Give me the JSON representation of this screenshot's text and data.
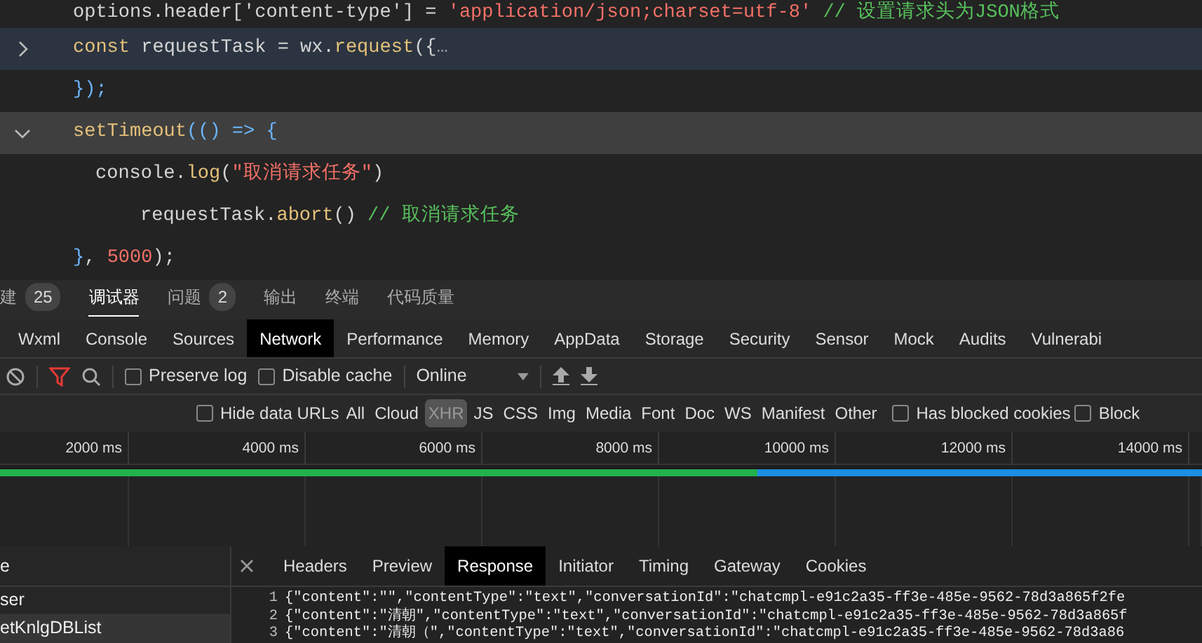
{
  "editor": {
    "lines": [
      {
        "current": false,
        "hovered": false,
        "tokens": [
          {
            "kind": "plain",
            "text": "options.header['content-type'] = "
          },
          {
            "kind": "string",
            "text": "'application/json;charset=utf-8'"
          },
          {
            "kind": "comment",
            "text": " // 设置请求头为JSON格式"
          }
        ]
      },
      {
        "current": true,
        "hovered": false,
        "expanded": false,
        "tokens": [
          {
            "kind": "keyword",
            "text": "const"
          },
          {
            "kind": "plain",
            "text": " requestTask =  wx."
          },
          {
            "kind": "function",
            "text": "request"
          },
          {
            "kind": "plain",
            "text": "({"
          },
          {
            "kind": "muted",
            "text": "…"
          }
        ]
      },
      {
        "current": false,
        "hovered": false,
        "tokens": [
          {
            "kind": "punct",
            "text": "});"
          }
        ]
      },
      {
        "current": false,
        "hovered": true,
        "expanded": true,
        "tokens": [
          {
            "kind": "function",
            "text": "setTimeout"
          },
          {
            "kind": "punct",
            "text": "(() => {"
          }
        ],
        "children": [
          {
            "current": false,
            "hovered": false,
            "tokens": [
              {
                "kind": "plain",
                "text": "console."
              },
              {
                "kind": "function",
                "text": "log"
              },
              {
                "kind": "plain",
                "text": "("
              },
              {
                "kind": "string",
                "text": "\"取消请求任务\""
              },
              {
                "kind": "plain",
                "text": ")"
              }
            ],
            "children": [
              {
                "current": false,
                "hovered": false,
                "tokens": [
                  {
                    "kind": "plain",
                    "text": "requestTask."
                  },
                  {
                    "kind": "function",
                    "text": "abort"
                  },
                  {
                    "kind": "plain",
                    "text": "() "
                  },
                  {
                    "kind": "comment",
                    "text": "// 取消请求任务"
                  }
                ]
              }
            ]
          }
        ]
      },
      {
        "current": false,
        "hovered": false,
        "tokens": [
          {
            "kind": "punct",
            "text": "}"
          },
          {
            "kind": "plain",
            "text": ", "
          },
          {
            "kind": "number",
            "text": "5000"
          },
          {
            "kind": "plain",
            "text": ");"
          }
        ]
      }
    ]
  },
  "panel_tabs": [
    {
      "label": "建",
      "count": "25",
      "selected": false
    },
    {
      "label": "调试器",
      "selected": true
    },
    {
      "label": "问题",
      "count": "2",
      "selected": false
    },
    {
      "label": "输出",
      "selected": false
    },
    {
      "label": "终端",
      "selected": false
    },
    {
      "label": "代码质量",
      "selected": false
    }
  ],
  "devtools_tabs": [
    {
      "label": "Wxml",
      "selected": false
    },
    {
      "label": "Console",
      "selected": false
    },
    {
      "label": "Sources",
      "selected": false
    },
    {
      "label": "Network",
      "selected": true
    },
    {
      "label": "Performance",
      "selected": false
    },
    {
      "label": "Memory",
      "selected": false
    },
    {
      "label": "AppData",
      "selected": false
    },
    {
      "label": "Storage",
      "selected": false
    },
    {
      "label": "Security",
      "selected": false
    },
    {
      "label": "Sensor",
      "selected": false
    },
    {
      "label": "Mock",
      "selected": false
    },
    {
      "label": "Audits",
      "selected": false
    },
    {
      "label": "Vulnerabi",
      "selected": false
    }
  ],
  "toolbar": {
    "preserve_log": {
      "label": "Preserve log",
      "checked": false
    },
    "disable_cache": {
      "label": "Disable cache",
      "checked": false
    },
    "throttling": "Online"
  },
  "filters": {
    "hide_data_urls": {
      "label": "Hide data URLs",
      "checked": false
    },
    "types": [
      {
        "label": "All",
        "selected": false
      },
      {
        "label": "Cloud",
        "selected": false
      },
      {
        "label": "XHR",
        "selected": true
      },
      {
        "label": "JS",
        "selected": false
      },
      {
        "label": "CSS",
        "selected": false
      },
      {
        "label": "Img",
        "selected": false
      },
      {
        "label": "Media",
        "selected": false
      },
      {
        "label": "Font",
        "selected": false
      },
      {
        "label": "Doc",
        "selected": false
      },
      {
        "label": "WS",
        "selected": false
      },
      {
        "label": "Manifest",
        "selected": false
      },
      {
        "label": "Other",
        "selected": false
      }
    ],
    "has_blocked_cookies": {
      "label": "Has blocked cookies",
      "checked": false
    },
    "blocked": {
      "label": "Block",
      "checked": false
    }
  },
  "timeline": {
    "ticks": [
      "2000 ms",
      "4000 ms",
      "6000 ms",
      "8000 ms",
      "10000 ms",
      "12000 ms",
      "14000 ms"
    ],
    "level": 0.63
  },
  "requests_header": "e",
  "requests": [
    {
      "name": "ser",
      "selected": false
    },
    {
      "name": "etKnlgDBList",
      "selected": true
    }
  ],
  "detail_tabs": [
    {
      "label": "Headers",
      "selected": false
    },
    {
      "label": "Preview",
      "selected": false
    },
    {
      "label": "Response",
      "selected": true
    },
    {
      "label": "Initiator",
      "selected": false
    },
    {
      "label": "Timing",
      "selected": false
    },
    {
      "label": "Gateway",
      "selected": false
    },
    {
      "label": "Cookies",
      "selected": false
    }
  ],
  "response_lines": [
    {
      "number": "1",
      "text": "{\"content\":\"\",\"contentType\":\"text\",\"conversationId\":\"chatcmpl-e91c2a35-ff3e-485e-9562-78d3a865f2fe"
    },
    {
      "number": "2",
      "text": "{\"content\":\"清朝\",\"contentType\":\"text\",\"conversationId\":\"chatcmpl-e91c2a35-ff3e-485e-9562-78d3a865f"
    },
    {
      "number": "3",
      "text": "{\"content\":\"清朝（\",\"contentType\":\"text\",\"conversationId\":\"chatcmpl-e91c2a35-ff3e-485e-9562-78d3a86"
    }
  ]
}
